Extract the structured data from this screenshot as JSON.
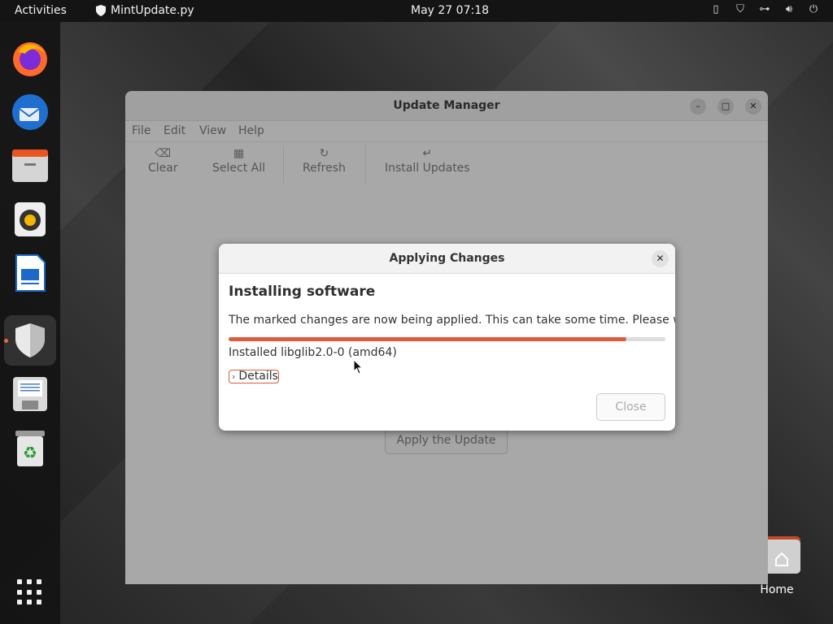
{
  "topbar": {
    "activities": "Activities",
    "app_name": "MintUpdate.py",
    "clock": "May 27  07:18"
  },
  "dock": {
    "items": [
      "firefox-icon",
      "thunderbird-icon",
      "files-icon",
      "rhythmbox-icon",
      "writer-icon",
      "update-manager-icon",
      "save-icon",
      "trash-icon"
    ],
    "accent": "#e95420"
  },
  "desktop": {
    "home_label": "Home"
  },
  "window": {
    "title": "Update Manager",
    "menu": [
      "File",
      "Edit",
      "View",
      "Help"
    ],
    "toolbar": {
      "clear": "Clear",
      "select_all": "Select All",
      "refresh": "Refresh",
      "install_updates": "Install Updates"
    },
    "apply_button": "Apply the Update"
  },
  "dialog": {
    "title": "Applying Changes",
    "heading": "Installing software",
    "message": "The marked changes are now being applied. This can take some time. Please wait.",
    "progress": 0.91,
    "status": "Installed libglib2.0-0 (amd64)",
    "details_label": "Details",
    "close_button": "Close",
    "accent": "#e05a3c"
  }
}
